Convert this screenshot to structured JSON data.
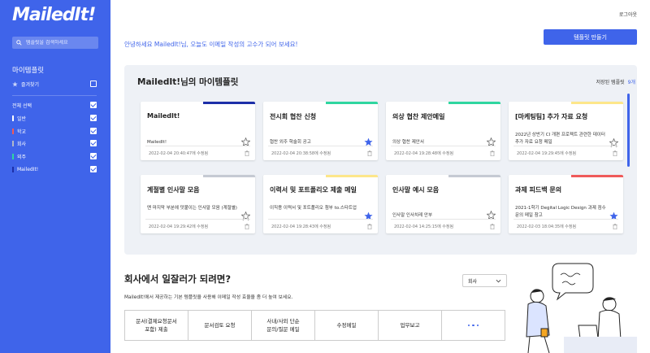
{
  "app": {
    "logo": "MailedIt!",
    "logout": "로그아웃"
  },
  "sidebar": {
    "search_placeholder": "템플릿을 검색하세요",
    "title": "마이템플릿",
    "favorites": "즐겨찾기",
    "select_all": "전체 선택",
    "categories": [
      {
        "label": "일반",
        "color": "#3f64ea"
      },
      {
        "label": "학교",
        "color": "#ef5a5a"
      },
      {
        "label": "회사",
        "color": "#b0b8c8"
      },
      {
        "label": "외주",
        "color": "#2fd6a0"
      },
      {
        "label": "MailedIt!",
        "color": "#1d2fa8"
      }
    ]
  },
  "header": {
    "greeting": "안녕하세요 MailedIt!님, 오늘도 이메일 작성의 고수가 되어 보세요!",
    "make_button": "템플릿 만들기"
  },
  "panel": {
    "title": "MailedIt!님의 마이템플릿",
    "saved_label": "저장된 템플릿",
    "saved_count": "9개"
  },
  "cards": [
    {
      "title": "MailedIt!",
      "desc": "MailedIt!",
      "date": "2022-02-04 20:40:47에 수정됨",
      "color": "#1d2fa8",
      "starred": false
    },
    {
      "title": "전시회 협찬 신청",
      "desc": "협찬 외주 학술회 공고",
      "date": "2022-02-04 20:38:58에 수정됨",
      "color": "#2fd6a0",
      "starred": true
    },
    {
      "title": "의상 협찬 제안메일",
      "desc": "의상 협찬 제안서",
      "date": "2022-02-04 19:28:48에 수정됨",
      "color": "#2fd6a0",
      "starred": false
    },
    {
      "title": "[마케팅팀] 추가 자료 요청",
      "desc": "2022년 상반기 CI 개편 프로젝트 관련한 데이터 추가 자료 요청 메일",
      "date": "2022-02-04 19:29:45에 수정됨",
      "color": "#fde68a",
      "starred": false
    },
    {
      "title": "계절별 인사말 모음",
      "desc": "맨 마지막 부분에 덧붙이는 인사말 모음 (계절별)",
      "date": "2022-02-04 19:29:42에 수정됨",
      "color": "#c5cad3",
      "starred": false
    },
    {
      "title": "이력서 및 포트폴리오 제출 메일",
      "desc": "이직용 이력서 및 포트폴리오 첨부 to.스타트업",
      "date": "2022-02-04 19:28:43에 수정됨",
      "color": "#fde68a",
      "starred": true
    },
    {
      "title": "인사말 예시 모음",
      "desc": "인사말 인사치레 안부",
      "date": "2022-02-04 14:25:15에 수정됨",
      "color": "#c5cad3",
      "starred": false
    },
    {
      "title": "과제 피드백 문의",
      "desc": "2021-1학기 Degital Logic Design 과제 점수 문의 메일 참고",
      "date": "2022-02-03 18:04:35에 수정됨",
      "color": "#ef5a5a",
      "starred": true
    }
  ],
  "section": {
    "title": "회사에서 일잘러가 되려면?",
    "desc": "MailedIt!에서 제공하는 기본 템플릿을 사용해 이메일 작성 효율을 좀 더 높여 보세요.",
    "select_value": "회사",
    "tiles": [
      "문서(결제요청문서\n포함) 제출",
      "문서검토 요청",
      "사내/사외 단순\n문의/질문 메일",
      "수정메일",
      "업무보고"
    ]
  },
  "colors": {
    "accent": "#3f64ea",
    "star": "#3f64ea"
  }
}
